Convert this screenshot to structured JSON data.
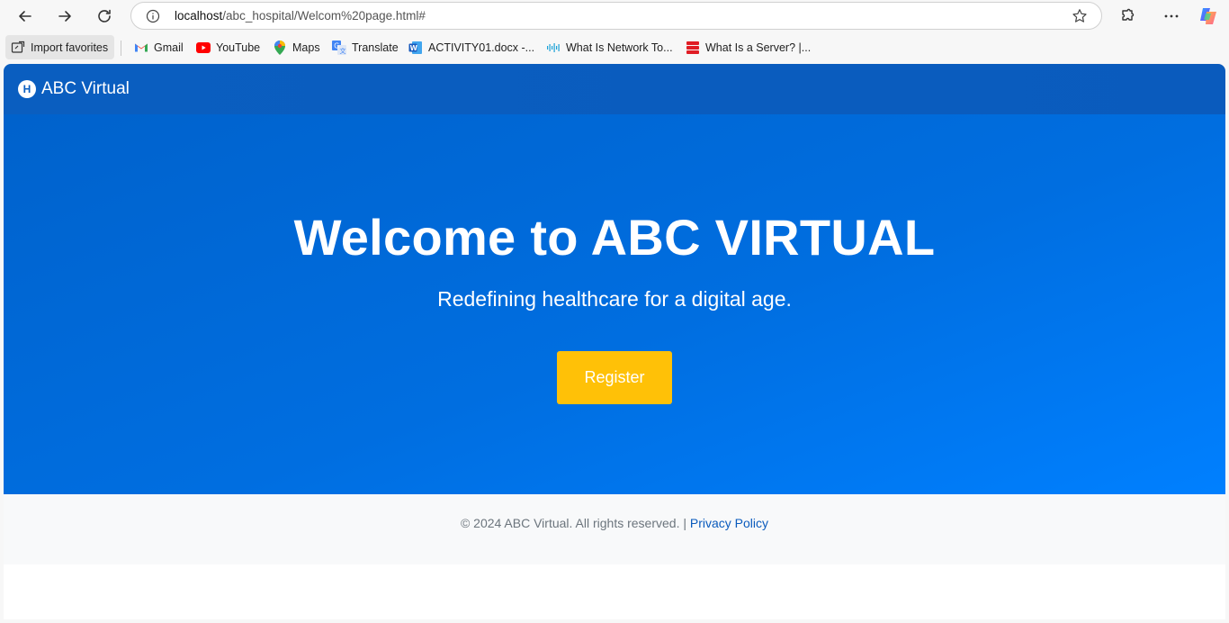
{
  "browser": {
    "url_host": "localhost",
    "url_path": "/abc_hospital/Welcom%20page.html#"
  },
  "favorites": {
    "import_label": "Import favorites",
    "items": [
      {
        "label": "Gmail",
        "icon": "gmail-icon"
      },
      {
        "label": "YouTube",
        "icon": "youtube-icon"
      },
      {
        "label": "Maps",
        "icon": "maps-icon"
      },
      {
        "label": "Translate",
        "icon": "translate-icon"
      },
      {
        "label": "ACTIVITY01.docx -...",
        "icon": "word-icon"
      },
      {
        "label": "What Is Network To...",
        "icon": "cisco-icon"
      },
      {
        "label": "What Is a Server? |...",
        "icon": "server-icon"
      }
    ]
  },
  "site": {
    "brand_logo_letter": "H",
    "brand": "ABC Virtual",
    "hero_title": "Welcome to ABC VIRTUAL",
    "hero_subtitle": "Redefining healthcare for a digital age.",
    "register_label": "Register",
    "footer_text": "© 2024 ABC Virtual. All rights reserved. | ",
    "footer_link": "Privacy Policy",
    "colors": {
      "nav": "#0a5ec0",
      "hero_start": "#0062cc",
      "hero_end": "#0080ff",
      "button": "#ffc107",
      "footer_bg": "#f8f9fa"
    }
  }
}
